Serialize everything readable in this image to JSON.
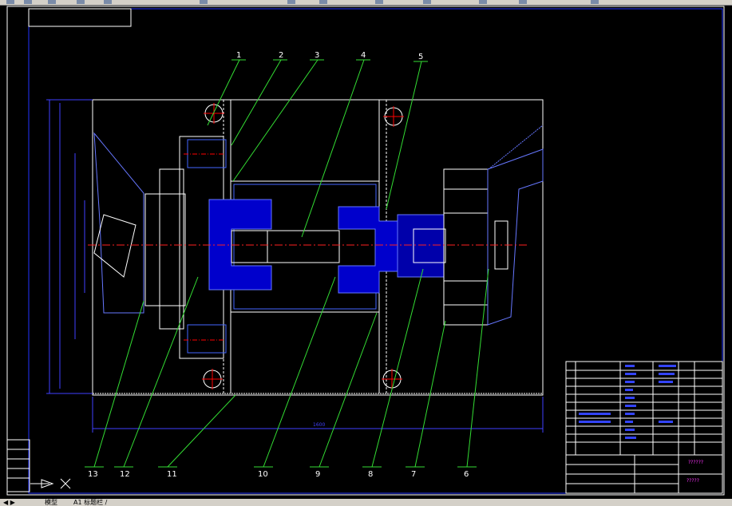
{
  "drawing": {
    "balloons": [
      "1",
      "2",
      "3",
      "4",
      "5",
      "13",
      "12",
      "11",
      "10",
      "9",
      "8",
      "7",
      "6"
    ],
    "overall_width_dim": "1600",
    "title_block_text": "??????",
    "title_block_sub": "?????"
  },
  "statusbar": {
    "tab_model": "模型",
    "tab_layout": "A1 标题栏 /"
  },
  "colors": {
    "background": "#000000",
    "frame": "#ffffff",
    "border": "#0000ff",
    "leader": "#33ff33",
    "part_fill": "#0000cc",
    "centerline": "#ff0000",
    "title_accent": "#ff00ff"
  }
}
